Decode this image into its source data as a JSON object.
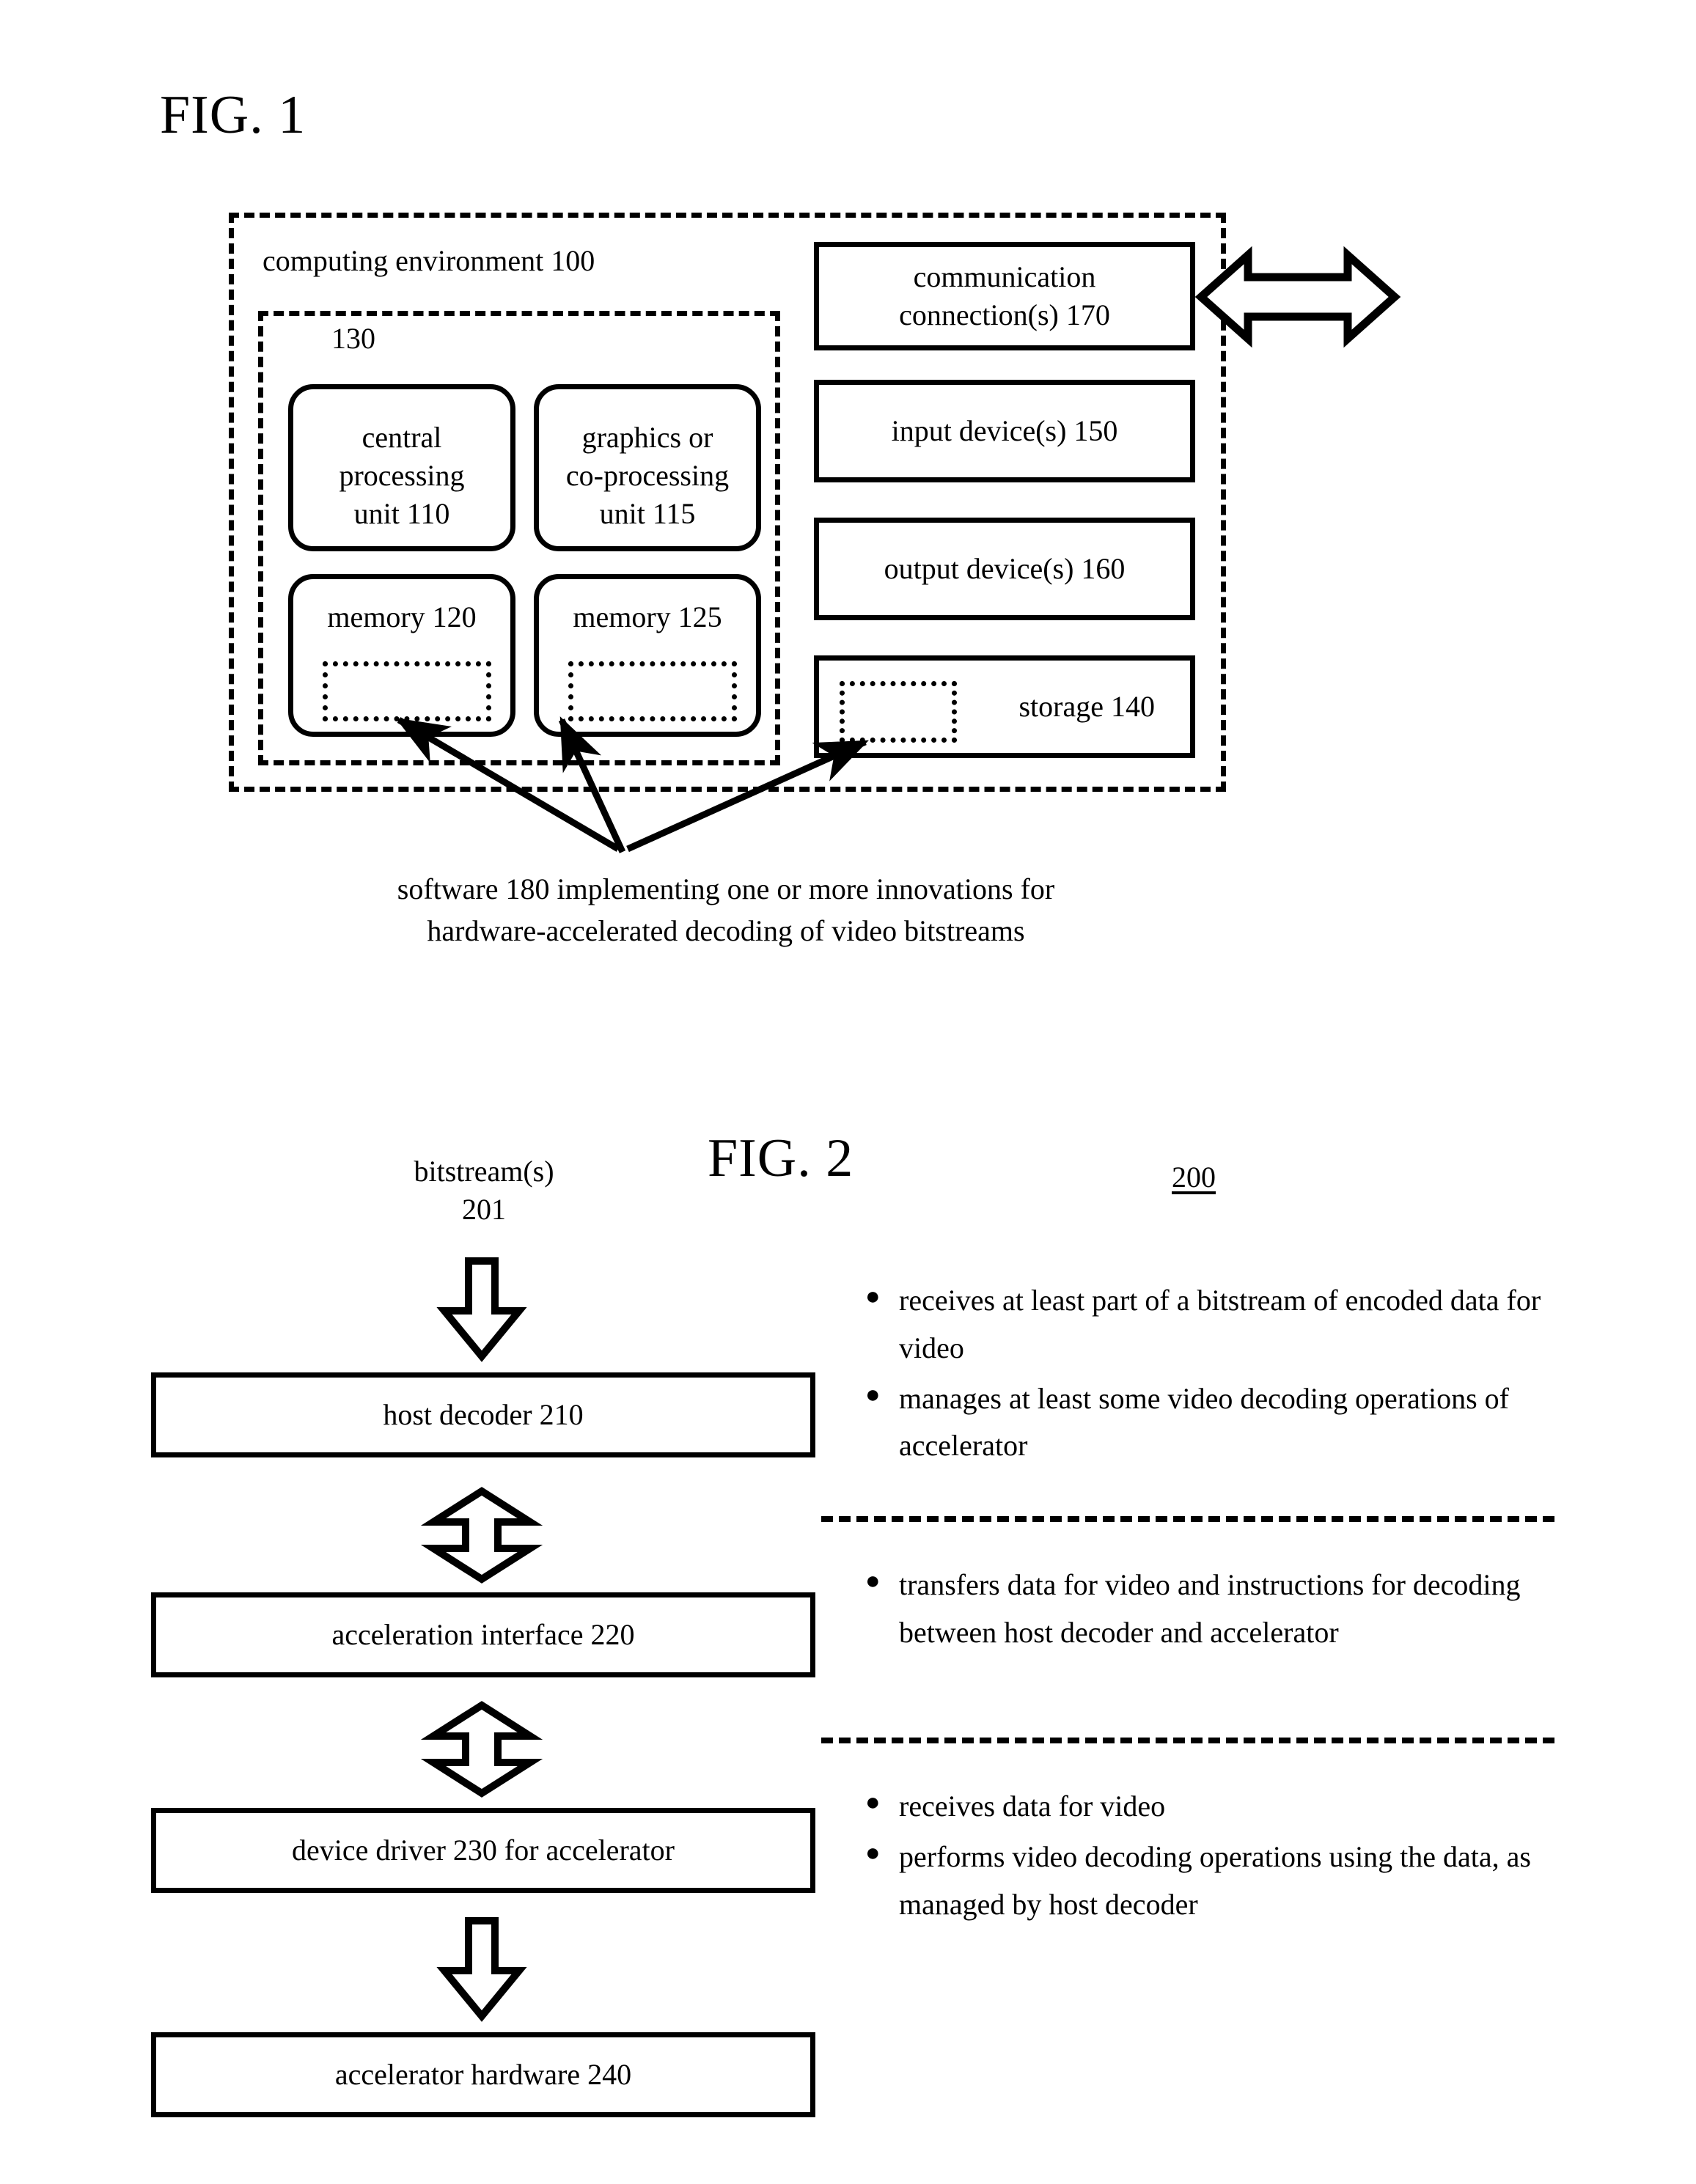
{
  "figure1": {
    "title": "FIG. 1",
    "environment_label": "computing environment 100",
    "processing_group_label": "130",
    "processing_units": [
      {
        "label": "central\nprocessing\nunit 110"
      },
      {
        "label": "graphics or\nco-processing\nunit 115"
      }
    ],
    "memories": [
      {
        "label": "memory 120"
      },
      {
        "label": "memory 125"
      }
    ],
    "right_boxes": [
      {
        "label": "communication\nconnection(s) 170"
      },
      {
        "label": "input device(s) 150"
      },
      {
        "label": "output device(s) 160"
      },
      {
        "label": "storage 140"
      }
    ],
    "caption": "software 180 implementing one or more innovations for\nhardware-accelerated decoding of video bitstreams"
  },
  "figure2": {
    "title": "FIG. 2",
    "ref_number": "200",
    "input_label": "bitstream(s)\n201",
    "boxes": [
      {
        "label": "host decoder 210"
      },
      {
        "label": "acceleration interface 220"
      },
      {
        "label": "device driver 230 for accelerator"
      },
      {
        "label": "accelerator hardware 240"
      }
    ],
    "bullet_groups": [
      {
        "items": [
          "receives at least part of a bitstream of encoded data for video",
          "manages at least some video decoding operations of accelerator"
        ]
      },
      {
        "items": [
          "transfers data for video and instructions for decoding between host decoder and accelerator"
        ]
      },
      {
        "items": [
          "receives data for video",
          "performs video decoding operations using the data, as managed by host decoder"
        ]
      }
    ],
    "bullet_glyph": "●"
  },
  "colors": {
    "ink": "#000000",
    "paper": "#ffffff"
  }
}
